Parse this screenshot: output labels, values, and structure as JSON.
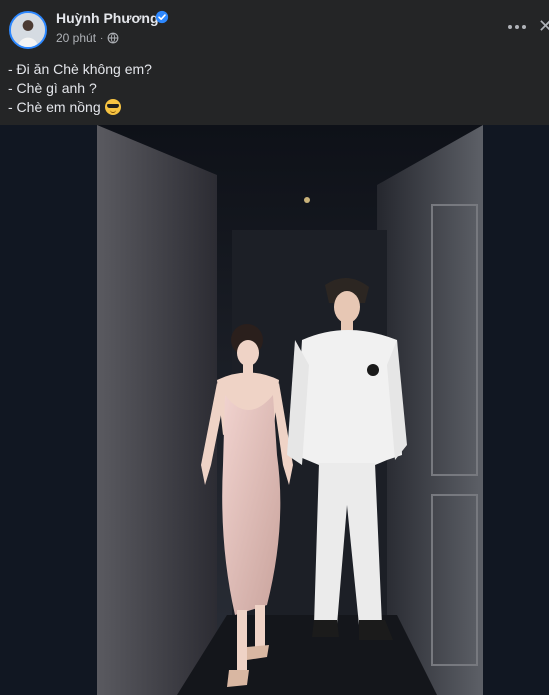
{
  "post": {
    "author": "Huỳnh Phương",
    "time": "20 phút",
    "separator": "·",
    "lines": [
      "- Đi ăn Chè không em?",
      "- Chè gì anh ?",
      "- Chè em nồng"
    ],
    "emoji": "sunglasses-emoji"
  },
  "icons": {
    "verified": "verified-badge-icon",
    "audience": "globe-icon",
    "more": "more-options-icon",
    "close": "close-icon"
  },
  "colors": {
    "background": "#242526",
    "photo_backdrop": "#111722",
    "verified": "#2d88ff",
    "text": "#e4e6eb",
    "secondary_text": "#b0b3b8"
  }
}
